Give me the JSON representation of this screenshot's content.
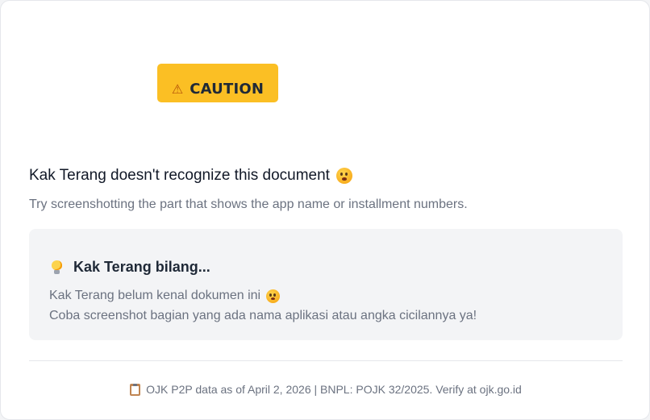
{
  "badge": {
    "icon": "warning-icon",
    "icon_glyph": "⚠",
    "label": "CAUTION",
    "color": "#fbbf24"
  },
  "message": {
    "headline": "Kak Terang doesn't recognize this document",
    "headline_icon": "flushed-face-icon",
    "subtext": "Try screenshotting the part that shows the app name or installment numbers."
  },
  "tip": {
    "icon": "light-bulb-icon",
    "title": "Kak Terang bilang...",
    "line1": "Kak Terang belum kenal dokumen ini",
    "line1_icon": "flushed-face-icon",
    "line2": "Coba screenshot bagian yang ada nama aplikasi atau angka cicilannya ya!"
  },
  "footer": {
    "icon": "clipboard-icon",
    "text": "OJK P2P data as of April 2, 2026 | BNPL: POJK 32/2025. Verify at ojk.go.id"
  }
}
